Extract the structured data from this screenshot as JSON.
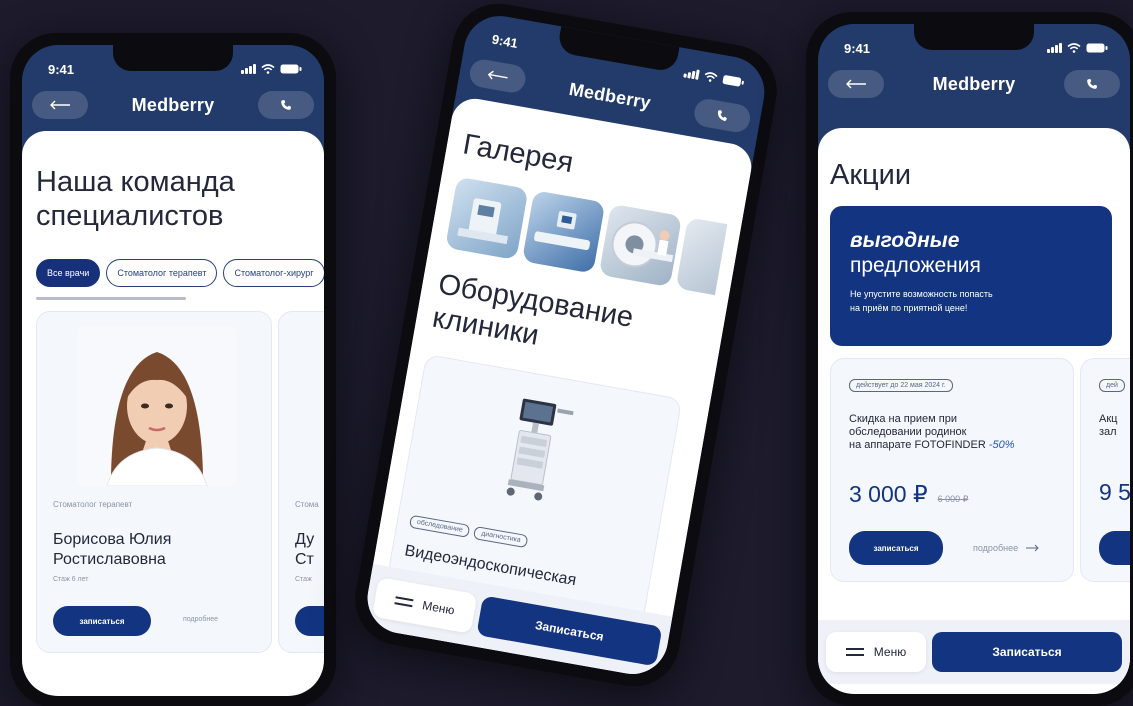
{
  "status": {
    "time": "9:41"
  },
  "brand": {
    "logo": "Medberry",
    "primary": "#133481",
    "header": "#233b6b",
    "background": "#1d1b2c"
  },
  "icons": {
    "back": "arrow-left-icon",
    "call": "phone-icon",
    "menu": "hamburger-icon",
    "more": "arrow-right-icon"
  },
  "bottom_bar": {
    "menu_label": "Меню",
    "book_label": "Записаться"
  },
  "team_screen": {
    "title_line1": "Наша команда",
    "title_line2": "специалистов",
    "filters": [
      "Все врачи",
      "Стоматолог терапевт",
      "Стоматолог-хирург"
    ],
    "doctor": {
      "specialty": "Стоматолог терапевт",
      "name_line1": "Борисова Юлия",
      "name_line2": "Ростиславовна",
      "experience": "Стаж 6 лет",
      "book_label": "записаться",
      "more_label": "подробнее"
    },
    "next_doctor": {
      "specialty": "Стома",
      "name_line1": "Ду",
      "name_line2": "Ст",
      "experience": "Стаж"
    }
  },
  "gallery_screen": {
    "gallery_title": "Галерея",
    "equipment_title_line1": "Оборудование",
    "equipment_title_line2": "клиники",
    "equipment": {
      "tags": [
        "обследование",
        "диагностика"
      ],
      "name": "Видеоэндоскопическая"
    }
  },
  "promo_screen": {
    "title": "Акции",
    "banner": {
      "line1": "выгодные",
      "line2": "предложения",
      "text_line1": "Не упустите возможность попасть",
      "text_line2": "на приём по приятной цене!"
    },
    "offer": {
      "valid": "действует до 22 мая 2024 г.",
      "line1": "Скидка на прием при",
      "line2": "обследовании родинок",
      "line3": "на аппарате FOTOFINDER",
      "discount": "-50%",
      "price": "3 000 ₽",
      "old_price": "6 000 ₽",
      "book_label": "записаться",
      "more_label": "подробнее"
    },
    "next_offer": {
      "valid": "дей",
      "line1": "Акц",
      "line2": "зал",
      "price": "9 5"
    }
  }
}
